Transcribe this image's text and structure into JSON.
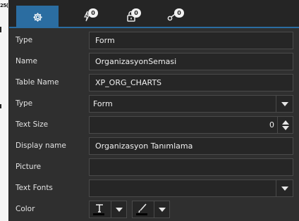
{
  "left_strip": {
    "number": "25("
  },
  "tabs": [
    {
      "icon": "gear-icon",
      "badge": null
    },
    {
      "icon": "lightning-icon",
      "badge": "0"
    },
    {
      "icon": "lock-icon",
      "badge": "0"
    },
    {
      "icon": "key-icon",
      "badge": "0"
    }
  ],
  "properties": {
    "type1": {
      "label": "Type",
      "value": "Form"
    },
    "name": {
      "label": "Name",
      "value": "OrganizasyonSemasi"
    },
    "table_name": {
      "label": "Table Name",
      "value": "XP_ORG_CHARTS"
    },
    "type2": {
      "label": "Type",
      "value": "Form"
    },
    "text_size": {
      "label": "Text Size",
      "value": "0"
    },
    "display_name": {
      "label": "Display name",
      "value": "Organizasyon Tanımlama"
    },
    "picture": {
      "label": "Picture",
      "value": ""
    },
    "text_fonts": {
      "label": "Text Fonts",
      "value": ""
    },
    "color": {
      "label": "Color"
    }
  },
  "colors": {
    "accent": "#2b6da1",
    "panel": "#2f2f2f",
    "field": "#262626"
  }
}
